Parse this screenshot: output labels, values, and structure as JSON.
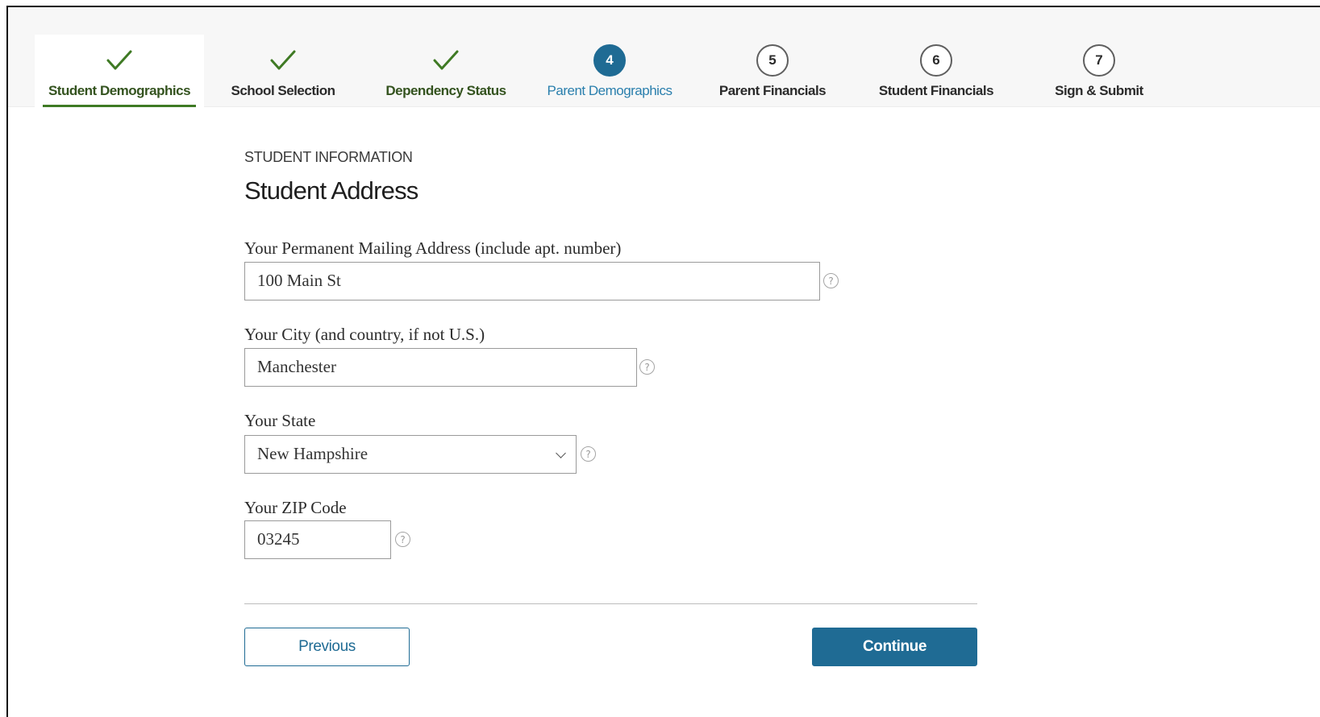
{
  "stepper": {
    "steps": [
      {
        "label": "Student Demographics",
        "state": "done",
        "marker": "",
        "icon": "checkmark-icon"
      },
      {
        "label": "School Selection",
        "state": "done",
        "marker": "",
        "icon": "checkmark-icon"
      },
      {
        "label": "Dependency Status",
        "state": "done",
        "marker": "",
        "icon": "checkmark-icon"
      },
      {
        "label": "Parent Demographics",
        "state": "current",
        "marker": "4"
      },
      {
        "label": "Parent Financials",
        "state": "upcoming",
        "marker": "5"
      },
      {
        "label": "Student Financials",
        "state": "upcoming",
        "marker": "6"
      },
      {
        "label": "Sign & Submit",
        "state": "upcoming",
        "marker": "7"
      }
    ]
  },
  "form": {
    "eyebrow": "STUDENT INFORMATION",
    "title": "Student Address",
    "fields": {
      "address": {
        "label": "Your Permanent Mailing Address (include apt. number)",
        "value": "100 Main St"
      },
      "city": {
        "label": "Your City (and country, if not U.S.)",
        "value": "Manchester"
      },
      "state": {
        "label": "Your State",
        "value": "New Hampshire"
      },
      "zip": {
        "label": "Your ZIP Code",
        "value": "03245"
      }
    },
    "help_glyph": "?"
  },
  "actions": {
    "previous_label": "Previous",
    "continue_label": "Continue"
  },
  "colors": {
    "primary": "#1f6b94",
    "done_green": "#3f7a24",
    "current_link": "#2a7fad"
  }
}
